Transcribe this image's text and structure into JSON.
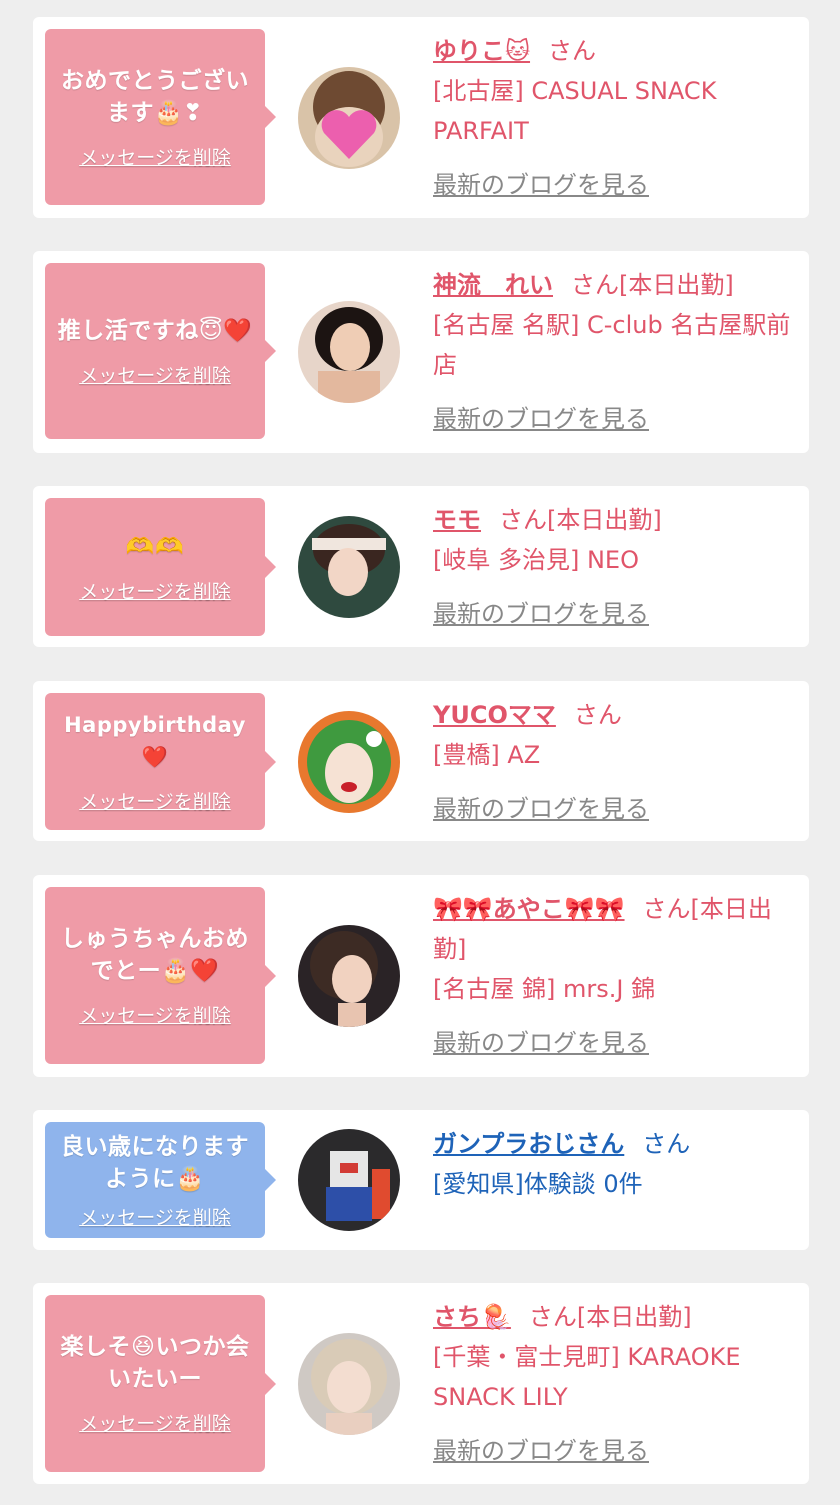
{
  "delete_label": "メッセージを削除",
  "blog_label": "最新のブログを見る",
  "honorific": "さん",
  "colors": {
    "pink_bubble": "#ef9ba7",
    "blue_bubble": "#8fb4ec",
    "pink_text": "#e0556a",
    "blue_text": "#1e63b8",
    "gray_link": "#888888"
  },
  "items": [
    {
      "message": "おめでとうございます🎂❣",
      "name": "ゆりこ🐱",
      "status": "さん",
      "shop": "[北古屋] CASUAL SNACK PARFAIT",
      "has_blog": true
    },
    {
      "message": "推し活ですね😇❤️",
      "name": "神流　れい",
      "status": "さん[本日出勤]",
      "shop": "[名古屋 名駅] C-club 名古屋駅前店",
      "has_blog": true
    },
    {
      "message": "🫶🫶",
      "name": "モモ",
      "status": "さん[本日出勤]",
      "shop": "[岐阜 多治見] NEO",
      "has_blog": true
    },
    {
      "message": "Happybirthday❤️",
      "name": "YUCOママ",
      "status": "さん",
      "shop": "[豊橋] AZ",
      "has_blog": true
    },
    {
      "message": "しゅうちゃんおめでとー🎂❤️",
      "name": "🎀🎀あやこ🎀🎀",
      "status": "さん[本日出勤]",
      "shop": "[名古屋 錦] mrs.J 錦",
      "has_blog": true
    },
    {
      "message": "良い歳になりますように🎂",
      "name": "ガンプラおじさん",
      "status": "さん",
      "shop": "[愛知県]体験談 0件",
      "has_blog": false
    },
    {
      "message": "楽しそ😆いつか会いたいー",
      "name": "さち🪼",
      "status": "さん[本日出勤]",
      "shop": "[千葉・富士見町] KARAOKE SNACK LILY",
      "has_blog": true
    }
  ]
}
